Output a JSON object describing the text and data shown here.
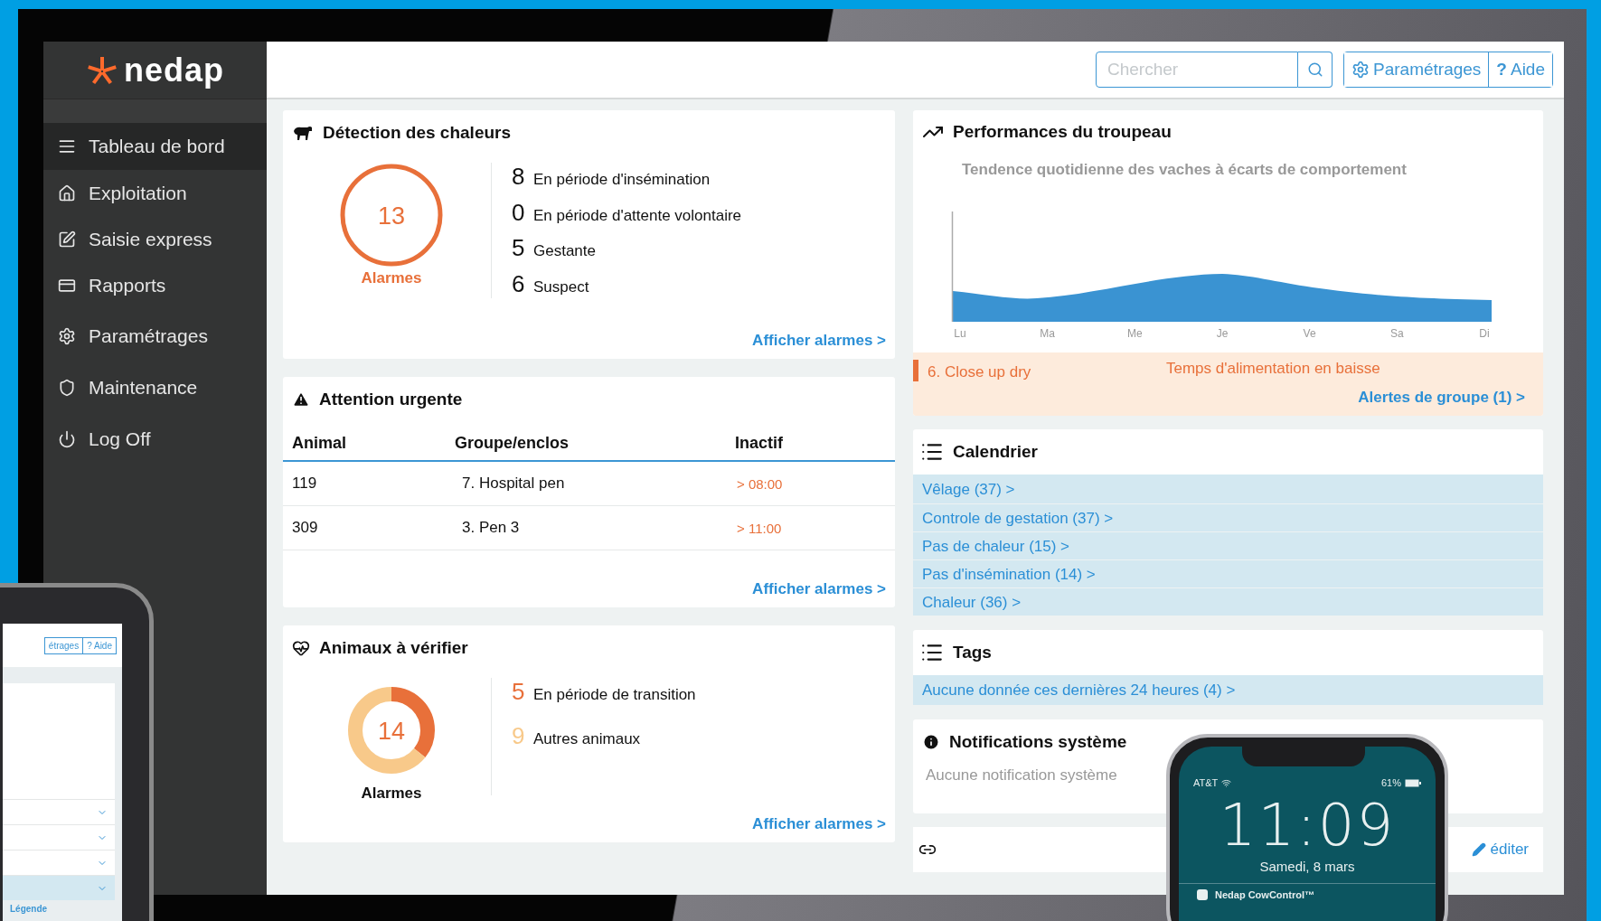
{
  "logo": {
    "text": "nedap"
  },
  "sidebar": {
    "items": [
      {
        "label": "Tableau de bord",
        "selected": true
      },
      {
        "label": "Exploitation",
        "selected": false
      },
      {
        "label": "Saisie express",
        "selected": false
      },
      {
        "label": "Rapports",
        "selected": false
      },
      {
        "label": "Paramétrages",
        "selected": false
      },
      {
        "label": "Maintenance",
        "selected": false
      },
      {
        "label": "Log Off",
        "selected": false
      }
    ]
  },
  "topbar": {
    "search": {
      "placeholder": "Chercher"
    },
    "settings": {
      "label": "Paramétrages"
    },
    "help": {
      "glyph": "?",
      "label": "Aide"
    }
  },
  "heat_detection": {
    "title": "Détection des chaleurs",
    "total": "13",
    "total_label": "Alarmes",
    "stats": [
      {
        "count": "8",
        "label": "En période d'insémination"
      },
      {
        "count": "0",
        "label": "En période d'attente volontaire"
      },
      {
        "count": "5",
        "label": "Gestante"
      },
      {
        "count": "6",
        "label": "Suspect"
      }
    ],
    "link": "Afficher alarmes >"
  },
  "urgent": {
    "title": "Attention urgente",
    "columns": [
      "Animal",
      "Groupe/enclos",
      "Inactif"
    ],
    "rows": [
      [
        "119",
        "7. Hospital pen",
        "> 08:00"
      ],
      [
        "309",
        "3. Pen 3",
        "> 11:00"
      ]
    ],
    "link": "Afficher alarmes >"
  },
  "animals_to_check": {
    "title": "Animaux à vérifier",
    "total": "14",
    "total_label": "Alarmes",
    "stats": [
      {
        "count": "5",
        "label": "En période de transition",
        "color": "#e8703a"
      },
      {
        "count": "9",
        "label": "Autres animaux",
        "color": "#f8c98a"
      }
    ],
    "link": "Afficher alarmes >"
  },
  "herd_performance": {
    "title": "Performances du troupeau",
    "subtitle": "Tendence quotidienne des vaches à écarts de comportement",
    "day_labels": [
      "Lu",
      "Ma",
      "Me",
      "Je",
      "Ve",
      "Sa",
      "Di"
    ],
    "alert": {
      "group": "6. Close up dry",
      "message": "Temps d'alimentation en baisse"
    },
    "link": "Alertes de groupe (1) >"
  },
  "calendar": {
    "title": "Calendrier",
    "items": [
      "Vêlage (37) >",
      "Controle de gestation (37) >",
      "Pas de chaleur (15) >",
      "Pas d'insémination (14) >",
      "Chaleur (36) >"
    ]
  },
  "tags": {
    "title": "Tags",
    "items": [
      "Aucune donnée ces dernières 24 heures (4) >"
    ]
  },
  "notifications": {
    "title": "Notifications système",
    "empty": "Aucune notification système"
  },
  "footer": {
    "edit": "éditer"
  },
  "tablet": {
    "buttons": [
      "étrages",
      "? Aide"
    ],
    "link": "Légende"
  },
  "phone": {
    "carrier": "AT&T",
    "battery": "61%",
    "time": "11:09",
    "date": "Samedi, 8 mars",
    "notification": "Nedap CowControl™"
  }
}
